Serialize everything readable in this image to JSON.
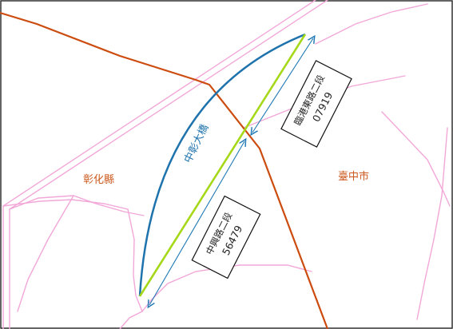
{
  "map": {
    "bridge_name": "中彰大橋",
    "regions": {
      "west": "彰化縣",
      "east": "臺中市"
    },
    "segments": {
      "north": {
        "road": "臨港東路二段",
        "code": "07919"
      },
      "south": {
        "road": "中興路二段",
        "code": "56479"
      }
    },
    "colors": {
      "frame": "#222222",
      "roads": "#f2a7d8",
      "boundary": "#cc4b0e",
      "bridge_arc": "#1f73ad",
      "bridge_line": "#a6d81a",
      "dimension_arrow": "#1f78b4",
      "region_label": "#cc5a20",
      "label_box_border": "#111111"
    }
  }
}
